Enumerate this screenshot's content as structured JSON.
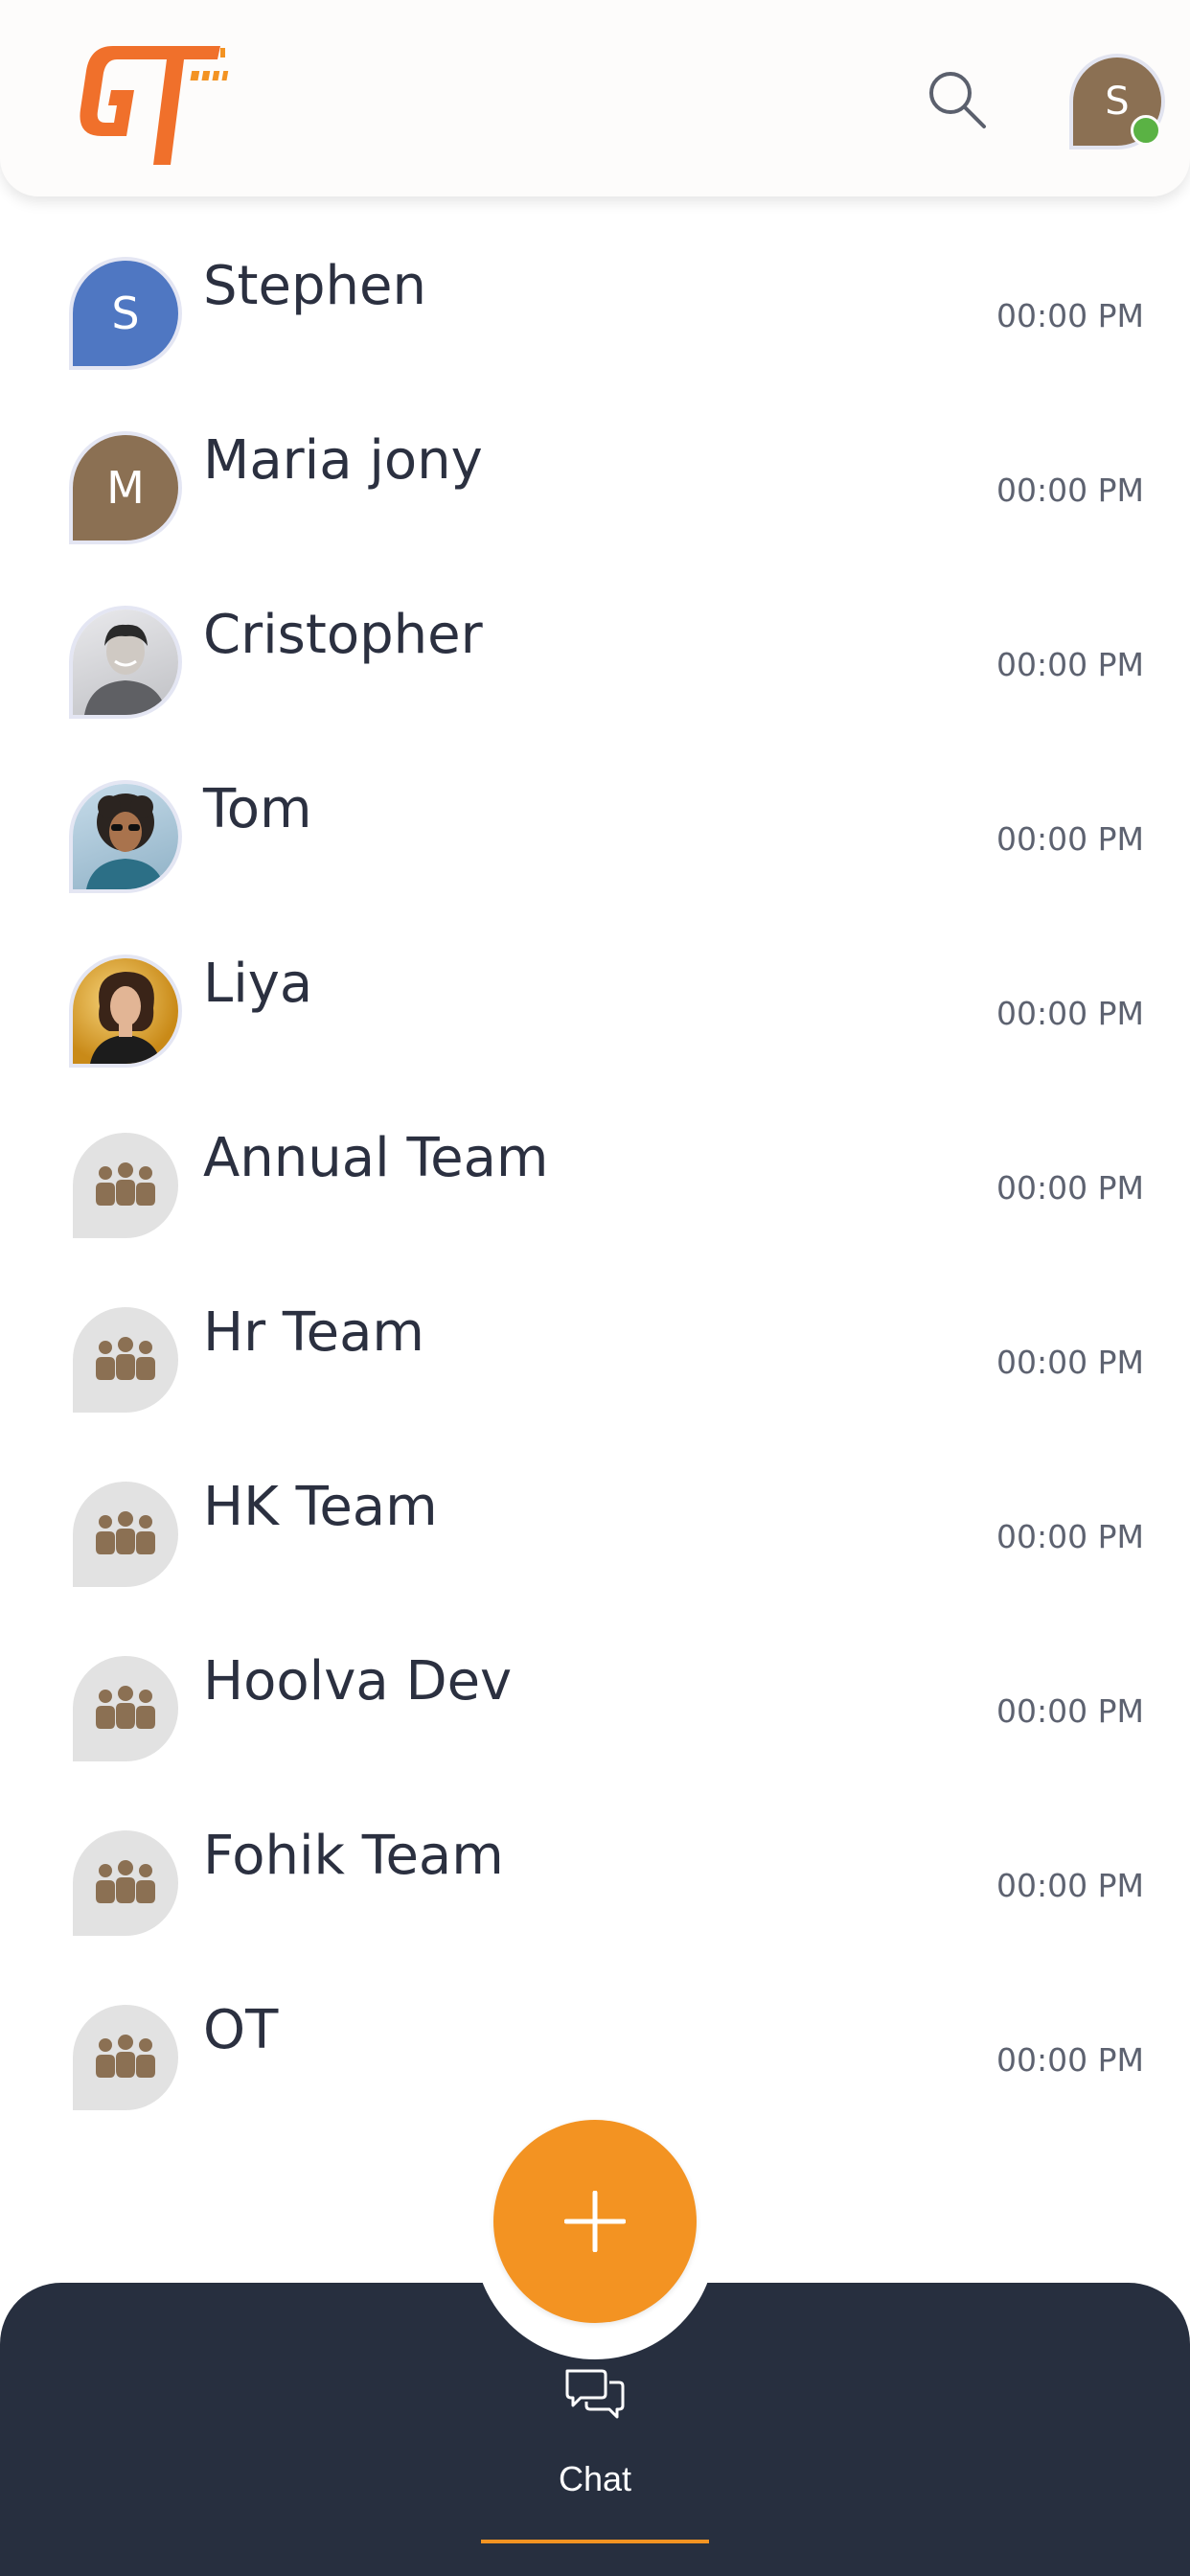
{
  "header": {
    "logo_text": "GT",
    "profile_initial": "S"
  },
  "chats": [
    {
      "name": "Stephen",
      "time": "00:00 PM",
      "avatar": "S",
      "avatar_type": "initial-blue"
    },
    {
      "name": "Maria jony",
      "time": "00:00 PM",
      "avatar": "M",
      "avatar_type": "initial-brown"
    },
    {
      "name": "Cristopher",
      "time": "00:00 PM",
      "avatar_type": "photo"
    },
    {
      "name": "Tom",
      "time": "00:00 PM",
      "avatar_type": "photo"
    },
    {
      "name": "Liya",
      "time": "00:00 PM",
      "avatar_type": "photo"
    },
    {
      "name": "Annual Team",
      "time": "00:00 PM",
      "avatar_type": "group-icon"
    },
    {
      "name": "Hr Team",
      "time": "00:00 PM",
      "avatar_type": "group-icon"
    },
    {
      "name": "HK Team",
      "time": "00:00 PM",
      "avatar_type": "group-icon"
    },
    {
      "name": "Hoolva Dev",
      "time": "00:00 PM",
      "avatar_type": "group-icon"
    },
    {
      "name": "Fohik Team",
      "time": "00:00 PM",
      "avatar_type": "group-icon"
    },
    {
      "name": "OT",
      "time": "00:00 PM",
      "avatar_type": "group-icon"
    }
  ],
  "bottom_nav": {
    "chat_label": "Chat"
  },
  "colors": {
    "accent": "#f39322",
    "nav_bg": "#272f3f",
    "online": "#5ab244",
    "group_icon": "#8b7053"
  }
}
